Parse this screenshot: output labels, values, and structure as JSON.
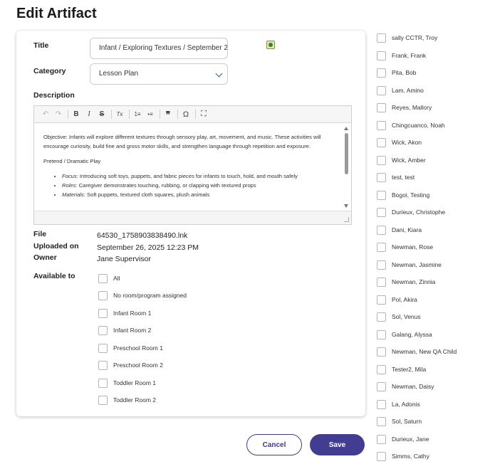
{
  "page_title": "Edit Artifact",
  "form": {
    "title_label": "Title",
    "title_value": "Infant / Exploring Textures / September 2",
    "category_label": "Category",
    "category_value": "Lesson Plan",
    "description_label": "Description",
    "description": {
      "objective": "Objective: Infants will explore different textures through sensory play, art, movement, and music. These activities will encourage curiosity, build fine and gross motor skills, and strengthen language through repetition and exposure.",
      "section": "Pretend / Dramatic Play",
      "bullets": [
        {
          "key": "Focus:",
          "text": " Introducing soft toys, puppets, and fabric pieces for infants to touch, hold, and mouth safely"
        },
        {
          "key": "Roles:",
          "text": " Caregiver demonstrates touching, rubbing, or clapping with textured props"
        },
        {
          "key": "Materials:",
          "text": " Soft puppets, textured cloth squares, plush animals"
        }
      ]
    },
    "toolbar_glyphs": {
      "undo": "↶",
      "redo": "↷",
      "bold": "B",
      "italic": "I",
      "strike": "S",
      "remove_format": "Tx",
      "numbered": "1≡",
      "bulleted": "•≡",
      "blockquote": "❞",
      "special_char": "Ω",
      "maximize": "⛶"
    },
    "file_label": "File",
    "file_value": "64530_1758903838490.lnk",
    "uploaded_label": "Uploaded on",
    "uploaded_value": "September 26, 2025 12:23 PM",
    "owner_label": "Owner",
    "owner_value": "Jane Supervisor",
    "available_label": "Available to",
    "rooms": [
      "All",
      "No room/program assigned",
      "Infant Room 1",
      "Infant Room 2",
      "Preschool Room 1",
      "Preschool Room 2",
      "Toddler Room 1",
      "Toddler Room 2"
    ]
  },
  "buttons": {
    "cancel": "Cancel",
    "save": "Save"
  },
  "people": [
    "sally CCTR, Troy",
    "Frank, Frank",
    "Pita, Bob",
    "Lam, Amino",
    "Reyes, Mallory",
    "Chingcuanco, Noah",
    "Wick, Akon",
    "Wick, Amber",
    "test, test",
    "Bogoi, Testing",
    "Durieux, Christophe",
    "Dani, Kiara",
    "Newman, Rose",
    "Newman, Jasmine",
    "Newman, Zinnia",
    "Pol, Akira",
    "Sol, Venus",
    "Galang, Alyssa",
    "Newman, New QA Child",
    "Tester2, Mila",
    "Newman, Daisy",
    "La, Adonis",
    "Sol, Saturn",
    "Durieux, Jane",
    "Simms, Cathy"
  ]
}
